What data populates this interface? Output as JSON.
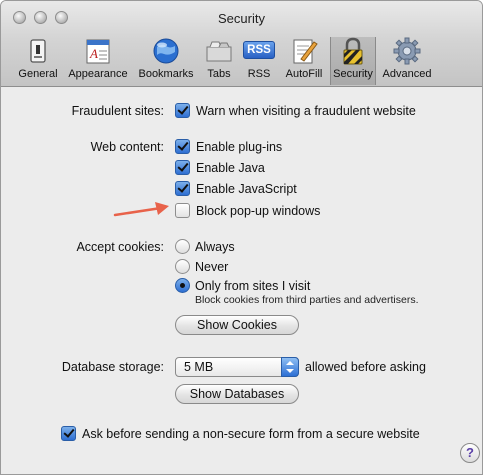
{
  "window": {
    "title": "Security"
  },
  "toolbar": [
    {
      "label": "General",
      "icon": "general-icon"
    },
    {
      "label": "Appearance",
      "icon": "appearance-icon"
    },
    {
      "label": "Bookmarks",
      "icon": "bookmarks-icon"
    },
    {
      "label": "Tabs",
      "icon": "tabs-icon"
    },
    {
      "label": "RSS",
      "icon": "rss-icon",
      "icon_text": "RSS"
    },
    {
      "label": "AutoFill",
      "icon": "autofill-icon"
    },
    {
      "label": "Security",
      "icon": "security-lock-icon",
      "selected": true
    },
    {
      "label": "Advanced",
      "icon": "advanced-gear-icon"
    }
  ],
  "fraudulent": {
    "label": "Fraudulent sites:",
    "option": {
      "label": "Warn when visiting a fraudulent website",
      "checked": true
    }
  },
  "web_content": {
    "label": "Web content:",
    "options": [
      {
        "label": "Enable plug-ins",
        "checked": true
      },
      {
        "label": "Enable Java",
        "checked": true
      },
      {
        "label": "Enable JavaScript",
        "checked": true
      },
      {
        "label": "Block pop-up windows",
        "checked": false
      }
    ]
  },
  "cookies": {
    "label": "Accept cookies:",
    "options": [
      {
        "label": "Always",
        "selected": false
      },
      {
        "label": "Never",
        "selected": false
      },
      {
        "label": "Only from sites I visit",
        "selected": true
      }
    ],
    "hint": "Block cookies from third parties and advertisers.",
    "show_button": "Show Cookies"
  },
  "database": {
    "label": "Database storage:",
    "value": "5 MB",
    "suffix": "allowed before asking",
    "show_button": "Show Databases"
  },
  "secure_form": {
    "label": "Ask before sending a non-secure form from a secure website",
    "checked": true
  },
  "help": {
    "label": "?"
  },
  "colors": {
    "accent": "#2e6fd2",
    "arrow": "#e8624a",
    "help": "#5a3fa8"
  }
}
